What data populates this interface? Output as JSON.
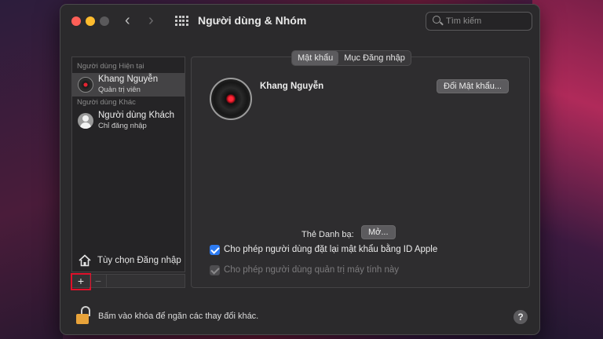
{
  "window": {
    "title": "Người dùng & Nhóm",
    "search_placeholder": "Tìm kiếm"
  },
  "sidebar": {
    "current_heading": "Người dùng Hiện tại",
    "other_heading": "Người dùng Khác",
    "users": [
      {
        "name": "Khang Nguyễn",
        "role": "Quản trị viên",
        "selected": true
      },
      {
        "name": "Người dùng Khách",
        "role": "Chỉ đăng nhập",
        "selected": false
      }
    ],
    "login_options_label": "Tùy chọn Đăng nhập",
    "add_label": "+",
    "remove_label": "−"
  },
  "tabs": [
    {
      "label": "Mật khẩu",
      "active": true
    },
    {
      "label": "Mục Đăng nhập",
      "active": false
    }
  ],
  "main": {
    "user_name": "Khang Nguyễn",
    "change_password_label": "Đổi Mật khẩu...",
    "contact_card_label": "Thẻ Danh bạ:",
    "open_label": "Mở...",
    "allow_reset_label": "Cho phép người dùng đặt lại mật khẩu bằng ID Apple",
    "allow_reset_checked": true,
    "allow_admin_label": "Cho phép người dùng quản trị máy tính này",
    "allow_admin_checked": true,
    "allow_admin_disabled": true
  },
  "footer": {
    "lock_text": "Bấm vào khóa để ngăn các thay đổi khác.",
    "help_label": "?"
  },
  "colors": {
    "accent": "#2d7bf2",
    "highlight": "#e0102a",
    "lock": "#e8a33a"
  }
}
